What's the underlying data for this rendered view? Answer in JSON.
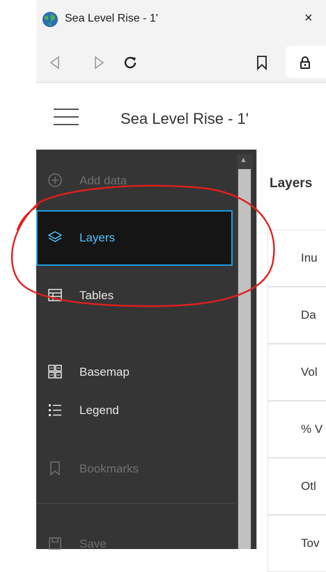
{
  "browser": {
    "tab_title": "Sea Level Rise - 1'",
    "close_glyph": "×",
    "nav_icons": [
      "back-icon",
      "forward-icon",
      "reload-icon",
      "bookmark-icon",
      "lock-icon"
    ]
  },
  "app": {
    "title": "Sea Level Rise - 1'"
  },
  "sidebar": {
    "items": [
      {
        "label": "Add data",
        "icon": "add-circle-icon",
        "state": "disabled"
      },
      {
        "label": "Layers",
        "icon": "layers-icon",
        "state": "selected"
      },
      {
        "label": "Tables",
        "icon": "table-icon",
        "state": "normal"
      },
      {
        "label": "Basemap",
        "icon": "basemap-icon",
        "state": "normal"
      },
      {
        "label": "Legend",
        "icon": "legend-icon",
        "state": "normal"
      },
      {
        "label": "Bookmarks",
        "icon": "bookmark-icon",
        "state": "disabled"
      },
      {
        "label": "Save",
        "icon": "save-icon",
        "state": "disabled"
      }
    ]
  },
  "panel": {
    "title": "Layers",
    "rows": [
      "Inu",
      "Da",
      "Vol",
      "% V",
      "Otl",
      "Tov"
    ]
  },
  "colors": {
    "sidebar_bg": "#353535",
    "selected_outline": "#1f9ee0",
    "annotation": "#e0201e"
  }
}
